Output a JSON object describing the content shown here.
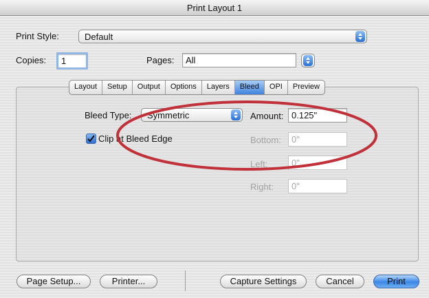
{
  "window": {
    "title": "Print Layout 1"
  },
  "print_style": {
    "label": "Print Style:",
    "value": "Default"
  },
  "copies": {
    "label": "Copies:",
    "value": "1"
  },
  "pages": {
    "label": "Pages:",
    "value": "All"
  },
  "tabs": [
    "Layout",
    "Setup",
    "Output",
    "Options",
    "Layers",
    "Bleed",
    "OPI",
    "Preview"
  ],
  "selected_tab": "Bleed",
  "bleed": {
    "type_label": "Bleed Type:",
    "type_value": "Symmetric",
    "clip_label": "Clip at Bleed Edge",
    "clip_checked": true,
    "amount_label": "Amount:",
    "amount_value": "0.125\"",
    "bottom_label": "Bottom:",
    "bottom_value": "0\"",
    "left_label": "Left:",
    "left_value": "0\"",
    "right_label": "Right:",
    "right_value": "0\""
  },
  "buttons": {
    "page_setup": "Page Setup...",
    "printer": "Printer...",
    "capture": "Capture Settings",
    "cancel": "Cancel",
    "print": "Print"
  },
  "annotation": {
    "color": "#c0313a"
  }
}
